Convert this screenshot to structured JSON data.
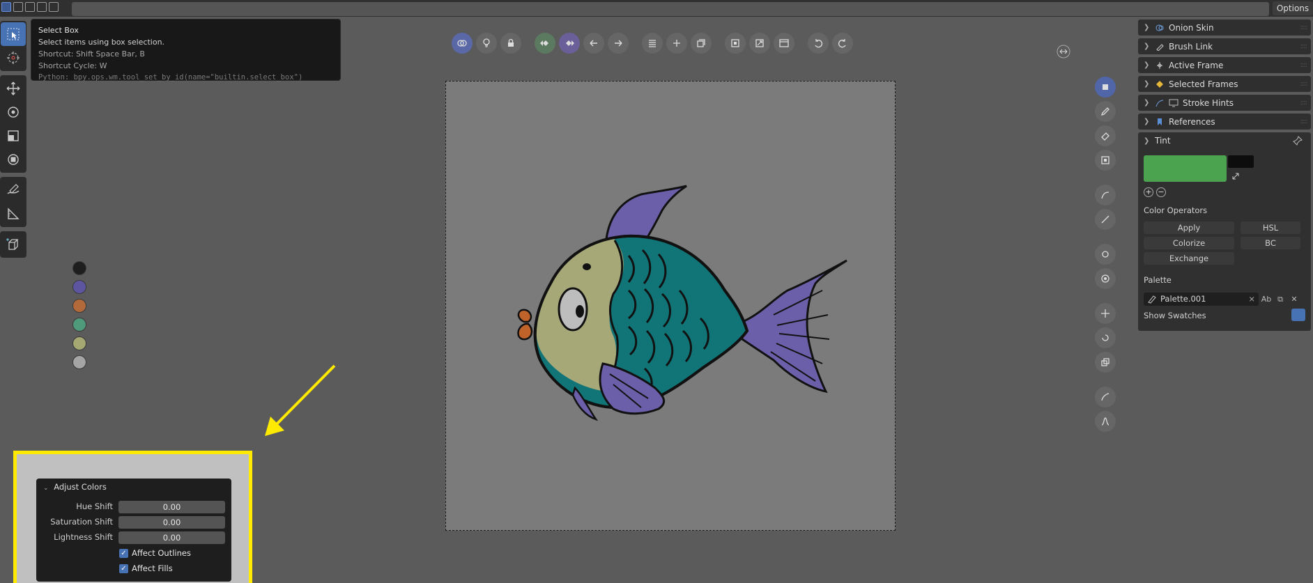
{
  "topbar": {
    "options_label": "Options"
  },
  "tooltip": {
    "title": "Select Box",
    "description": "Select items using box selection.",
    "shortcut": "Shortcut: Shift Space Bar, B",
    "shortcut_cycle": "Shortcut Cycle: W",
    "python": "Python: bpy.ops.wm.tool_set_by_id(name=\"builtin.select_box\")"
  },
  "toolbar": {
    "tools": [
      "select-box",
      "cursor",
      "move",
      "rotate",
      "scale",
      "transform",
      "annotate",
      "measure",
      "add-cube"
    ]
  },
  "header_icons": [
    "overlay",
    "light",
    "lock",
    "keyframe-prev",
    "keyframe-next",
    "arrow-left",
    "arrow-right",
    "list",
    "add",
    "duplicate",
    "frame-selected",
    "fullscreen",
    "window",
    "undo",
    "redo"
  ],
  "palette_colors": [
    "#1e1e1e",
    "#5d55a0",
    "#b26a3a",
    "#4f9a7a",
    "#a6a874",
    "#a5a5a5"
  ],
  "side_panel": {
    "collapsed_sections": [
      {
        "label": "Onion Skin",
        "icon": "onion-icon"
      },
      {
        "label": "Brush Link",
        "icon": "brush-icon"
      },
      {
        "label": "Active Frame",
        "icon": "frame-icon"
      },
      {
        "label": "Selected Frames",
        "icon": "diamond-icon"
      },
      {
        "label": "Stroke Hints",
        "icon": "monitor-icon"
      },
      {
        "label": "References",
        "icon": "bookmark-icon"
      }
    ],
    "tint": {
      "header": "Tint",
      "primary_color": "#4ba34f",
      "secondary_color": "#0d0d0d",
      "color_operators_label": "Color Operators",
      "buttons": {
        "apply": "Apply",
        "hsl": "HSL",
        "colorize": "Colorize",
        "bc": "BC",
        "exchange": "Exchange"
      },
      "palette_label": "Palette",
      "palette_name": "Palette.001",
      "show_swatches_label": "Show Swatches"
    }
  },
  "adjust_colors": {
    "header": "Adjust Colors",
    "hue_shift": {
      "label": "Hue Shift",
      "value": "0.00"
    },
    "saturation_shift": {
      "label": "Saturation Shift",
      "value": "0.00"
    },
    "lightness_shift": {
      "label": "Lightness Shift",
      "value": "0.00"
    },
    "affect_outlines": {
      "label": "Affect Outlines",
      "checked": true
    },
    "affect_fills": {
      "label": "Affect Fills",
      "checked": true
    }
  },
  "colors": {
    "accent": "#4772b3",
    "highlight": "#ffea00"
  }
}
